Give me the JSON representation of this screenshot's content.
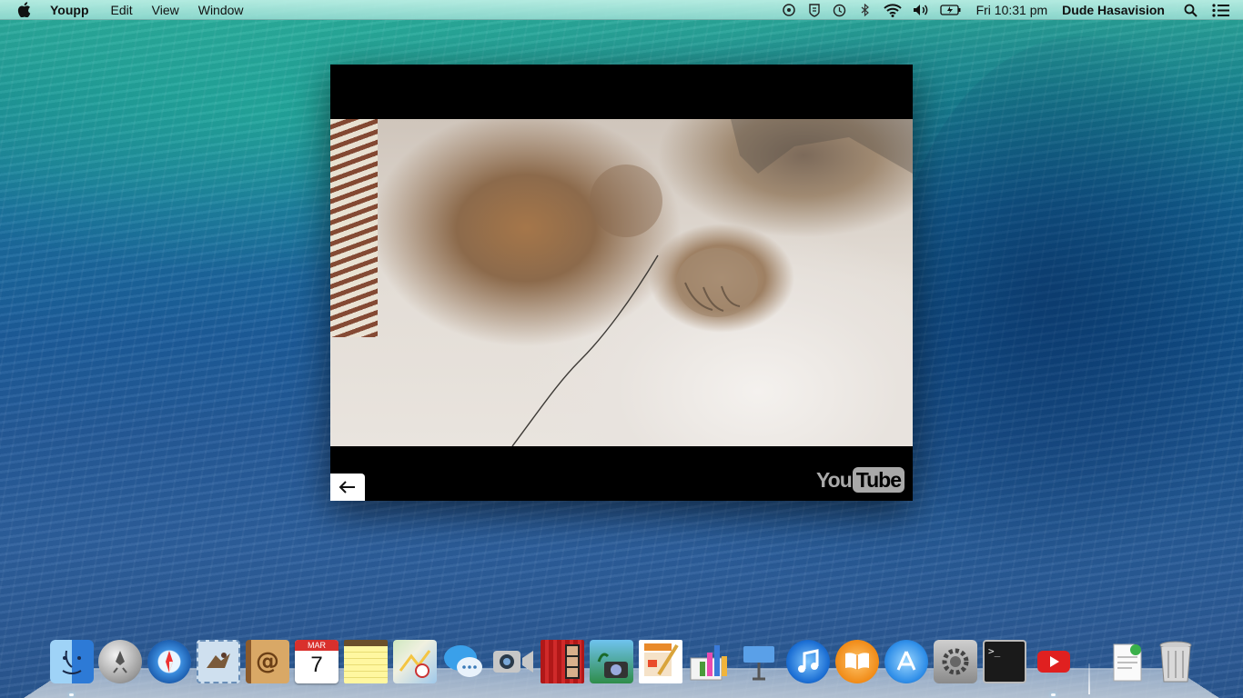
{
  "menubar": {
    "app_name": "Youpp",
    "menus": [
      "Edit",
      "View",
      "Window"
    ],
    "clock": "Fri 10:31 pm",
    "user": "Dude Hasavision",
    "status_icons": [
      "accessibility-icon",
      "shield-icon",
      "time-machine-icon",
      "bluetooth-icon",
      "wifi-icon",
      "volume-icon",
      "battery-icon",
      "spotlight-icon",
      "notification-center-icon"
    ]
  },
  "player": {
    "logo_you": "You",
    "logo_tube": "Tube",
    "back_label": "←"
  },
  "dock": {
    "apps": [
      {
        "name": "Finder",
        "icon": "finder-icon",
        "running": true
      },
      {
        "name": "Launchpad",
        "icon": "launchpad-icon",
        "running": false
      },
      {
        "name": "Safari",
        "icon": "safari-icon",
        "running": false
      },
      {
        "name": "Mail",
        "icon": "mail-icon",
        "running": false
      },
      {
        "name": "Contacts",
        "icon": "contacts-icon",
        "running": false
      },
      {
        "name": "Calendar",
        "icon": "calendar-icon",
        "running": false,
        "month": "MAR",
        "day": "7"
      },
      {
        "name": "Notes",
        "icon": "notes-icon",
        "running": false
      },
      {
        "name": "Maps",
        "icon": "maps-icon",
        "running": false
      },
      {
        "name": "Messages",
        "icon": "messages-icon",
        "running": false
      },
      {
        "name": "FaceTime",
        "icon": "facetime-icon",
        "running": false
      },
      {
        "name": "Photo Booth",
        "icon": "photo-booth-icon",
        "running": false
      },
      {
        "name": "iPhoto",
        "icon": "iphoto-icon",
        "running": false
      },
      {
        "name": "Pages",
        "icon": "pages-icon",
        "running": false
      },
      {
        "name": "Numbers",
        "icon": "numbers-icon",
        "running": false
      },
      {
        "name": "Keynote",
        "icon": "keynote-icon",
        "running": false
      },
      {
        "name": "iTunes",
        "icon": "itunes-icon",
        "running": false
      },
      {
        "name": "iBooks",
        "icon": "ibooks-icon",
        "running": false
      },
      {
        "name": "App Store",
        "icon": "app-store-icon",
        "running": false
      },
      {
        "name": "System Preferences",
        "icon": "system-preferences-icon",
        "running": false
      },
      {
        "name": "Terminal",
        "icon": "terminal-icon",
        "running": false,
        "prompt": ">_"
      },
      {
        "name": "Youpp",
        "icon": "youtube-icon",
        "running": true
      }
    ],
    "stack": {
      "name": "Document Stack",
      "icon": "document-stack-icon"
    },
    "trash": {
      "name": "Trash",
      "icon": "trash-icon"
    }
  }
}
